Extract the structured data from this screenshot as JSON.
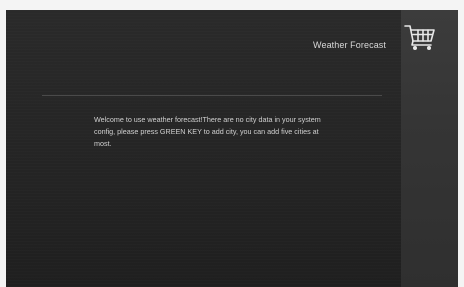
{
  "app": {
    "title": "Weather Forecast"
  },
  "header": {
    "icon": "shopping-cart-icon"
  },
  "main": {
    "message": "Welcome to use weather forecast!There are no city data in your system config, please press GREEN KEY to add city, you can add five cities at most."
  },
  "colors": {
    "background": "#262626",
    "panel": "#383838",
    "text": "#d8d8d8"
  }
}
